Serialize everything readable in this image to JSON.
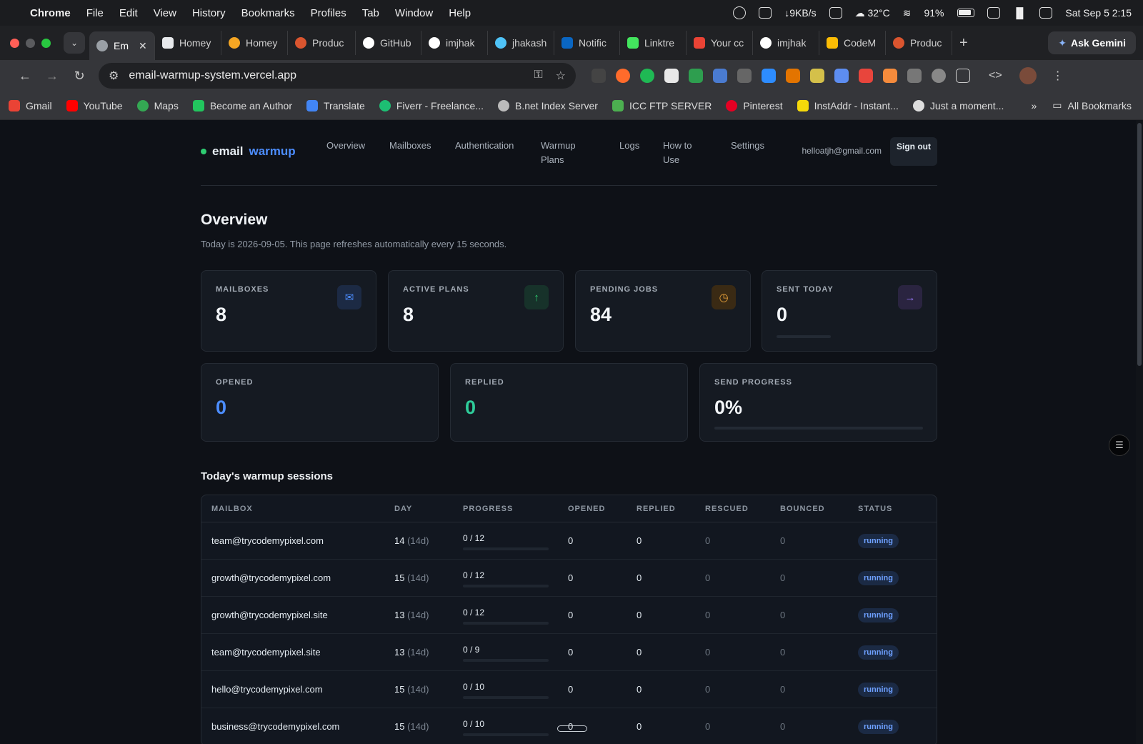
{
  "os_menu": {
    "app": "Chrome",
    "items": [
      "File",
      "Edit",
      "View",
      "History",
      "Bookmarks",
      "Profiles",
      "Tab",
      "Window",
      "Help"
    ],
    "net_speed": "↓9KB/s",
    "weather": "32°C",
    "battery": "91%",
    "datetime": "Sat Sep 5  2:15"
  },
  "tabs": [
    {
      "label": "Em",
      "color": "#9aa0a6",
      "active": true
    },
    {
      "label": "Homey",
      "color": "#e8eaed"
    },
    {
      "label": "Homey",
      "color": "#f5a623"
    },
    {
      "label": "Produc",
      "color": "#da552f"
    },
    {
      "label": "GitHub",
      "color": "#ffffff"
    },
    {
      "label": "imjhak",
      "color": "#ffffff"
    },
    {
      "label": "jhakash",
      "color": "#4fc3f7"
    },
    {
      "label": "Notific",
      "color": "#0a66c2"
    },
    {
      "label": "Linktre",
      "color": "#43e55e"
    },
    {
      "label": "Your cc",
      "color": "#ea4335"
    },
    {
      "label": "imjhak",
      "color": "#ffffff"
    },
    {
      "label": "CodeM",
      "color": "#fbbc04"
    },
    {
      "label": "Produc",
      "color": "#da552f"
    }
  ],
  "ask_gemini": "Ask Gemini",
  "address": {
    "url": "email-warmup-system.vercel.app"
  },
  "bookmarks": [
    {
      "label": "Gmail",
      "color": "#ea4335"
    },
    {
      "label": "YouTube",
      "color": "#ff0000"
    },
    {
      "label": "Maps",
      "color": "#34a853"
    },
    {
      "label": "Become an Author",
      "color": "#22c55e"
    },
    {
      "label": "Translate",
      "color": "#4285f4"
    },
    {
      "label": "Fiverr - Freelance...",
      "color": "#1dbf73"
    },
    {
      "label": "B.net Index Server",
      "color": "#bbbbbb"
    },
    {
      "label": "ICC FTP SERVER",
      "color": "#4caf50"
    },
    {
      "label": "Pinterest",
      "color": "#e60023"
    },
    {
      "label": "InstAddr - Instant...",
      "color": "#f5d90a"
    },
    {
      "label": "Just a moment...",
      "color": "#dddddd"
    }
  ],
  "all_bookmarks": "All Bookmarks",
  "app": {
    "brand_1": "email",
    "brand_2": "warmup",
    "nav": [
      "Overview",
      "Mailboxes",
      "Authentication",
      "Warmup Plans",
      "Logs",
      "How to Use",
      "Settings"
    ],
    "user_email": "helloatjh@gmail.com",
    "sign_out": "Sign out"
  },
  "overview": {
    "title": "Overview",
    "subtitle": "Today is 2026-09-05. This page refreshes automatically every 15 seconds."
  },
  "stats": {
    "mailboxes": {
      "label": "MAILBOXES",
      "value": "8"
    },
    "active_plans": {
      "label": "ACTIVE PLANS",
      "value": "8"
    },
    "pending_jobs": {
      "label": "PENDING JOBS",
      "value": "84"
    },
    "sent_today": {
      "label": "SENT TODAY",
      "value": "0"
    },
    "opened": {
      "label": "OPENED",
      "value": "0"
    },
    "replied": {
      "label": "REPLIED",
      "value": "0"
    },
    "send_progress": {
      "label": "SEND PROGRESS",
      "value": "0%",
      "fraction": 0
    }
  },
  "sessions": {
    "title": "Today's warmup sessions",
    "columns": [
      "MAILBOX",
      "DAY",
      "PROGRESS",
      "OPENED",
      "REPLIED",
      "RESCUED",
      "BOUNCED",
      "STATUS"
    ],
    "rows": [
      {
        "mailbox": "team@trycodemypixel.com",
        "day": "14",
        "span": "(14d)",
        "progress": "0 / 12",
        "opened": "0",
        "replied": "0",
        "rescued": "0",
        "bounced": "0",
        "status": "running"
      },
      {
        "mailbox": "growth@trycodemypixel.com",
        "day": "15",
        "span": "(14d)",
        "progress": "0 / 12",
        "opened": "0",
        "replied": "0",
        "rescued": "0",
        "bounced": "0",
        "status": "running"
      },
      {
        "mailbox": "growth@trycodemypixel.site",
        "day": "13",
        "span": "(14d)",
        "progress": "0 / 12",
        "opened": "0",
        "replied": "0",
        "rescued": "0",
        "bounced": "0",
        "status": "running"
      },
      {
        "mailbox": "team@trycodemypixel.site",
        "day": "13",
        "span": "(14d)",
        "progress": "0 / 9",
        "opened": "0",
        "replied": "0",
        "rescued": "0",
        "bounced": "0",
        "status": "running"
      },
      {
        "mailbox": "hello@trycodemypixel.com",
        "day": "15",
        "span": "(14d)",
        "progress": "0 / 10",
        "opened": "0",
        "replied": "0",
        "rescued": "0",
        "bounced": "0",
        "status": "running"
      },
      {
        "mailbox": "business@trycodemypixel.com",
        "day": "15",
        "span": "(14d)",
        "progress": "0 / 10",
        "opened": "0",
        "replied": "0",
        "rescued": "0",
        "bounced": "0",
        "status": "running"
      }
    ]
  },
  "colors": {
    "accent_blue": "#4c8dff",
    "accent_green": "#2ecc71",
    "accent_orange": "#e9a23b",
    "accent_purple": "#9b7bff"
  }
}
